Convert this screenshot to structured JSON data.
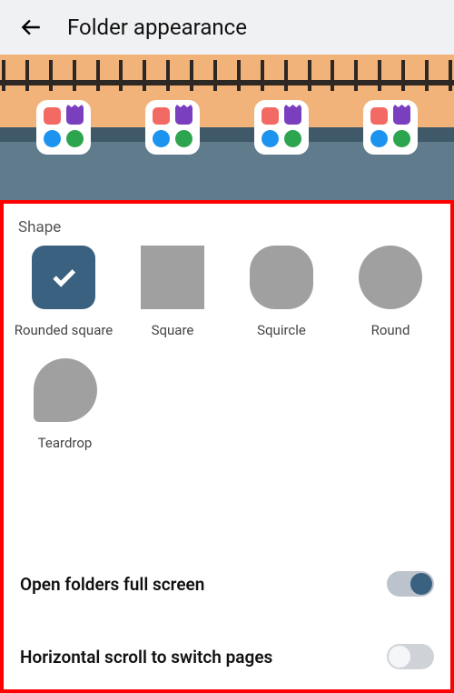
{
  "header": {
    "title": "Folder appearance"
  },
  "section": {
    "shape_label": "Shape"
  },
  "shapes": {
    "rounded_square": "Rounded square",
    "square": "Square",
    "squircle": "Squircle",
    "round": "Round",
    "teardrop": "Teardrop"
  },
  "settings": {
    "open_full_screen": "Open folders full screen",
    "horizontal_scroll": "Horizontal scroll to switch pages"
  },
  "colors": {
    "accent": "#3a6180",
    "highlight": "#ff0000"
  }
}
